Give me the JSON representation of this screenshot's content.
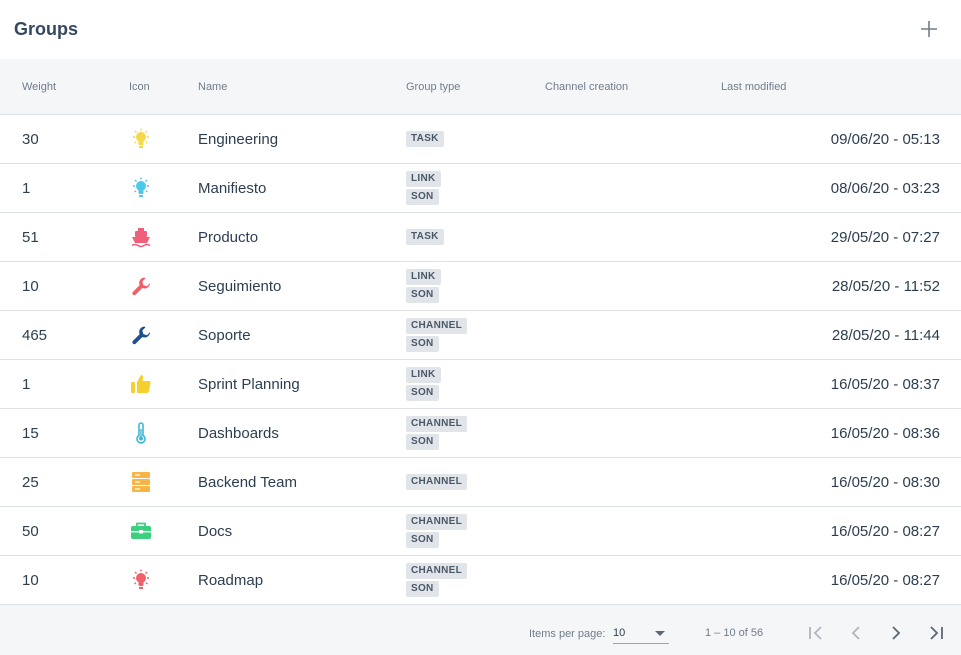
{
  "header": {
    "title": "Groups",
    "add_icon": "plus-icon"
  },
  "columns": {
    "weight": "Weight",
    "icon": "Icon",
    "name": "Name",
    "group_type": "Group type",
    "channel_creation": "Channel creation",
    "last_modified": "Last modified"
  },
  "rows": [
    {
      "weight": "30",
      "icon": "lightbulb-icon",
      "icon_color": "#f5d94a",
      "name": "Engineering",
      "types": [
        "TASK"
      ],
      "modified": "09/06/20 - 05:13"
    },
    {
      "weight": "1",
      "icon": "lightbulb-icon",
      "icon_color": "#4cc9e8",
      "name": "Manifiesto",
      "types": [
        "LINK",
        "SON"
      ],
      "modified": "08/06/20 - 03:23"
    },
    {
      "weight": "51",
      "icon": "ship-icon",
      "icon_color": "#f0607a",
      "name": "Producto",
      "types": [
        "TASK"
      ],
      "modified": "29/05/20 - 07:27"
    },
    {
      "weight": "10",
      "icon": "wrench-icon",
      "icon_color": "#f0606a",
      "name": "Seguimiento",
      "types": [
        "LINK",
        "SON"
      ],
      "modified": "28/05/20 - 11:52"
    },
    {
      "weight": "465",
      "icon": "wrench-icon",
      "icon_color": "#1d4f91",
      "name": "Soporte",
      "types": [
        "CHANNEL",
        "SON"
      ],
      "modified": "28/05/20 - 11:44"
    },
    {
      "weight": "1",
      "icon": "thumbs-up-icon",
      "icon_color": "#f5d030",
      "name": "Sprint Planning",
      "types": [
        "LINK",
        "SON"
      ],
      "modified": "16/05/20 - 08:37"
    },
    {
      "weight": "15",
      "icon": "thermometer-icon",
      "icon_color": "#40b8d8",
      "name": "Dashboards",
      "types": [
        "CHANNEL",
        "SON"
      ],
      "modified": "16/05/20 - 08:36"
    },
    {
      "weight": "25",
      "icon": "server-icon",
      "icon_color": "#f7b546",
      "name": "Backend Team",
      "types": [
        "CHANNEL"
      ],
      "modified": "16/05/20 - 08:30"
    },
    {
      "weight": "50",
      "icon": "toolbox-icon",
      "icon_color": "#3ccf80",
      "name": "Docs",
      "types": [
        "CHANNEL",
        "SON"
      ],
      "modified": "16/05/20 - 08:27"
    },
    {
      "weight": "10",
      "icon": "lightbulb-icon",
      "icon_color": "#f0606a",
      "name": "Roadmap",
      "types": [
        "CHANNEL",
        "SON"
      ],
      "modified": "16/05/20 - 08:27"
    }
  ],
  "pagination": {
    "items_per_page_label": "Items per page:",
    "items_per_page_value": "10",
    "range_label": "1 – 10 of 56"
  }
}
